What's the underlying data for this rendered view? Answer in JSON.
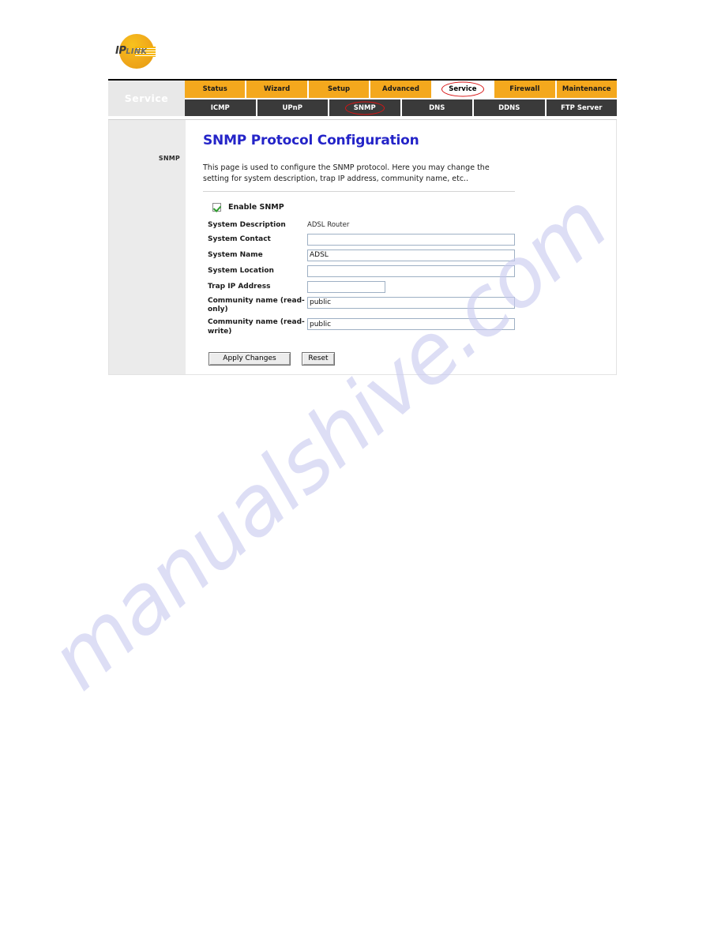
{
  "brand": {
    "logo_text_main": "IP",
    "logo_text_sub": "LINK",
    "logo_icon": "iplink-logo-icon",
    "logo_color": "#f0a81a"
  },
  "nav": {
    "section_title": "Service",
    "primary_tabs": [
      {
        "label": "Status",
        "active": false
      },
      {
        "label": "Wizard",
        "active": false
      },
      {
        "label": "Setup",
        "active": false
      },
      {
        "label": "Advanced",
        "active": false
      },
      {
        "label": "Service",
        "active": true,
        "annotated": true
      },
      {
        "label": "Firewall",
        "active": false
      },
      {
        "label": "Maintenance",
        "active": false
      }
    ],
    "secondary_tabs": [
      {
        "label": "ICMP",
        "active": false
      },
      {
        "label": "UPnP",
        "active": false
      },
      {
        "label": "SNMP",
        "active": true,
        "annotated": true
      },
      {
        "label": "DNS",
        "active": false
      },
      {
        "label": "DDNS",
        "active": false
      },
      {
        "label": "FTP Server",
        "active": false
      }
    ],
    "annotation_color": "#d81515",
    "tab_bg_color": "#f4a81d",
    "subtab_bg_color": "#3a3a3a"
  },
  "sidebar": {
    "items": [
      {
        "label": "SNMP"
      }
    ]
  },
  "main": {
    "title": "SNMP Protocol Configuration",
    "title_color": "#2424c8",
    "description": "This page is used to configure the SNMP protocol. Here you may change the setting for system description, trap IP address, community name, etc..",
    "enable_checkbox": {
      "label": "Enable SNMP",
      "checked": true
    },
    "fields": [
      {
        "label": "System Description",
        "type": "static",
        "value": "ADSL Router"
      },
      {
        "label": "System Contact",
        "type": "input",
        "value": "",
        "width": "wide"
      },
      {
        "label": "System Name",
        "type": "input",
        "value": "ADSL",
        "width": "wide"
      },
      {
        "label": "System Location",
        "type": "input",
        "value": "",
        "width": "wide"
      },
      {
        "label": "Trap IP Address",
        "type": "input",
        "value": "",
        "width": "narrow"
      },
      {
        "label": "Community name (read-only)",
        "type": "input",
        "value": "public",
        "width": "wide"
      },
      {
        "label": "Community name (read-write)",
        "type": "input",
        "value": "public",
        "width": "wide"
      }
    ],
    "buttons": {
      "apply_label": "Apply Changes",
      "reset_label": "Reset"
    }
  },
  "watermark": {
    "text": "manualshive.com",
    "color": "#c9cbf0"
  }
}
